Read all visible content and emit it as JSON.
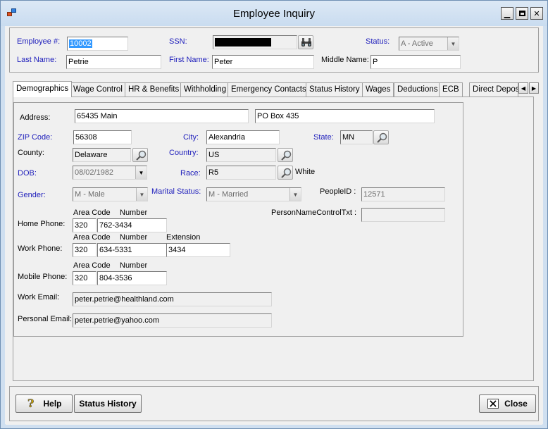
{
  "window": {
    "title": "Employee Inquiry"
  },
  "header": {
    "employee_label": "Employee #:",
    "employee_value": "10002",
    "ssn_label": "SSN:",
    "status_label": "Status:",
    "status_value": "A - Active",
    "last_name_label": "Last Name:",
    "last_name_value": "Petrie",
    "first_name_label": "First Name:",
    "first_name_value": "Peter",
    "middle_name_label": "Middle Name:",
    "middle_name_value": "P"
  },
  "tabs": [
    {
      "label": "Demographics"
    },
    {
      "label": "Wage Control"
    },
    {
      "label": "HR & Benefits"
    },
    {
      "label": "Withholding"
    },
    {
      "label": "Emergency Contacts"
    },
    {
      "label": "Status History"
    },
    {
      "label": "Wages"
    },
    {
      "label": "Deductions"
    },
    {
      "label": "ECB"
    },
    {
      "label": "Direct Deposi"
    }
  ],
  "demographics": {
    "address_label": "Address:",
    "address1": "65435 Main",
    "address2": "PO Box 435",
    "zip_label": "ZIP Code:",
    "zip_value": "56308",
    "city_label": "City:",
    "city_value": "Alexandria",
    "state_label": "State:",
    "state_value": "MN",
    "county_label": "County:",
    "county_value": "Delaware",
    "country_label": "Country:",
    "country_value": "US",
    "dob_label": "DOB:",
    "dob_value": "08/02/1982",
    "race_label": "Race:",
    "race_value": "R5",
    "race_desc": "White",
    "gender_label": "Gender:",
    "gender_value": "M - Male",
    "marital_label": "Marital Status:",
    "marital_value": "M - Married",
    "people_id_label": "PeopleID :",
    "people_id_value": "12571",
    "person_name_ctrl_label": "PersonNameControlTxt :",
    "person_name_ctrl_value": "",
    "area_code_header": "Area Code",
    "number_header": "Number",
    "extension_header": "Extension",
    "home_phone_label": "Home Phone:",
    "home_area": "320",
    "home_number": "762-3434",
    "work_phone_label": "Work Phone:",
    "work_area": "320",
    "work_number": "634-5331",
    "work_extension": "3434",
    "mobile_phone_label": "Mobile Phone:",
    "mobile_area": "320",
    "mobile_number": "804-3536",
    "work_email_label": "Work Email:",
    "work_email_value": "peter.petrie@healthland.com",
    "personal_email_label": "Personal Email:",
    "personal_email_value": "peter.petrie@yahoo.com"
  },
  "footer": {
    "help_label": "Help",
    "status_history_label": "Status History",
    "close_label": "Close"
  },
  "colors": {
    "label_blue": "#1d1dbb",
    "selection": "#3399ff"
  },
  "icons": [
    "app-icon",
    "minimize-icon",
    "maximize-icon",
    "close-icon",
    "binoculars-icon",
    "magnifier-icon",
    "help-icon",
    "close-x-icon",
    "chevron-down-icon",
    "arrow-left-icon",
    "arrow-right-icon"
  ]
}
